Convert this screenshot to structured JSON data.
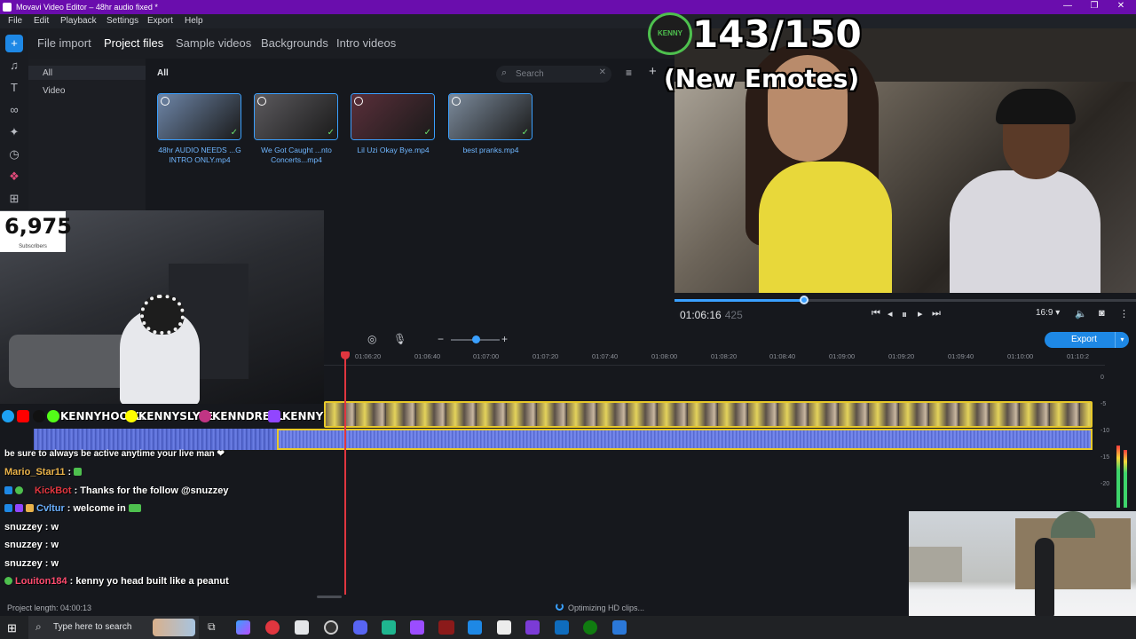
{
  "window": {
    "title": "Movavi Video Editor – 48hr audio fixed *",
    "controls": [
      "—",
      "❐",
      "✕"
    ]
  },
  "menu": [
    "File",
    "Edit",
    "Playback",
    "Settings",
    "Export",
    "Help"
  ],
  "rail": {
    "icons": [
      "plus-icon",
      "music-icon",
      "text-icon",
      "transitions-icon",
      "magic-icon",
      "clock-icon",
      "stickers-icon",
      "more-icon"
    ]
  },
  "tabs": [
    "File import",
    "Project files",
    "Sample videos",
    "Backgrounds",
    "Intro videos"
  ],
  "active_tab": "Project files",
  "side_panel": {
    "items": [
      "All",
      "Video"
    ]
  },
  "media": {
    "header": "All",
    "search_placeholder": "Search",
    "files": [
      {
        "label": "48hr AUDIO NEEDS ...G INTRO ONLY.mp4",
        "color": "#6e86a8"
      },
      {
        "label": "We Got Caught ...nto Concerts...mp4",
        "color": "#5c5a5e"
      },
      {
        "label": "Lil Uzi Okay Bye.mp4",
        "color": "#5a2f3a"
      },
      {
        "label": "best pranks.mp4",
        "color": "#7c8b9c"
      }
    ]
  },
  "overlay": {
    "count": "143/150",
    "subtitle": "(New Emotes)",
    "logo_text": "KENNY"
  },
  "player": {
    "timecode": "01:06:16",
    "timecode_ms": "425",
    "progress": 0.28,
    "aspect": "16:9 ▾"
  },
  "timeline": {
    "zoom": 0.5,
    "export_label": "Export",
    "ticks": [
      "01:06:20",
      "01:06:40",
      "01:07:00",
      "01:07:20",
      "01:07:40",
      "01:08:00",
      "01:08:20",
      "01:08:40",
      "01:09:00",
      "01:09:20",
      "01:09:40",
      "01:10:00",
      "01:10:2"
    ],
    "vu_labels": [
      "0",
      "-5",
      "-10",
      "-15",
      "-20"
    ]
  },
  "status": {
    "project_length": "Project length: 04:00:13",
    "optimizing": "Optimizing HD clips..."
  },
  "taskbar": {
    "search_placeholder": "Type here to search"
  },
  "stream": {
    "subscribers": "6,975",
    "subscribers_label": "Subscribers",
    "socials": [
      "KENNYHOOPZ",
      "KENNYSLYFE",
      "KENNDRELL",
      "KENNY"
    ],
    "chat": [
      {
        "user": "",
        "text": "be sure to always be active anytime your live man ❤",
        "color": "#ffffff"
      },
      {
        "user": "Mario_Star11",
        "text": ":",
        "color": "#e9b24a"
      },
      {
        "user": "KickBot",
        "text": ": Thanks for the follow @snuzzey",
        "color": "#e0363f"
      },
      {
        "user": "Cvltur",
        "text": ": welcome in",
        "color": "#6ab0ff"
      },
      {
        "user": "snuzzey",
        "text": ": w",
        "color": "#ffffff"
      },
      {
        "user": "snuzzey",
        "text": ": w",
        "color": "#ffffff"
      },
      {
        "user": "snuzzey",
        "text": ": w",
        "color": "#ffffff"
      },
      {
        "user": "Louiton184",
        "text": ": kenny yo head built like a peanut",
        "color": "#ff4b6e"
      }
    ]
  }
}
